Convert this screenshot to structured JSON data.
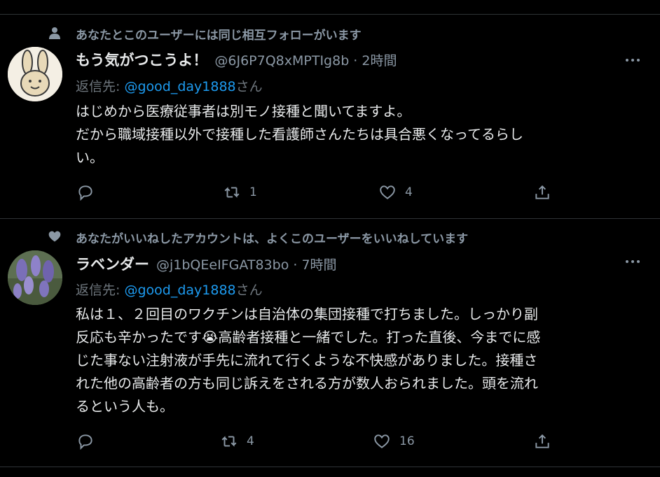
{
  "tweets": [
    {
      "social_context": "あなたとこのユーザーには同じ相互フォローがいます",
      "social_icon": "person-icon",
      "display_name": "もう気がつこうよ！",
      "handle_time": "@6J6P7Q8xMPTIg8b · 2時間",
      "reply_prefix": "返信先: ",
      "reply_mention": "@good_day1888",
      "reply_suffix": "さん",
      "body_lines": [
        "はじめから医療従事者は別モノ接種と聞いてますよ。",
        "だから職域接種以外で接種した看護師さんたちは具合悪くなってるらし",
        "い。"
      ],
      "retweets": "1",
      "likes": "4"
    },
    {
      "social_context": "あなたがいいねしたアカウントは、よくこのユーザーをいいねしています",
      "social_icon": "heart-icon",
      "display_name": "ラベンダー",
      "handle_time": "@j1bQEeIFGAT83bo · 7時間",
      "reply_prefix": "返信先: ",
      "reply_mention": "@good_day1888",
      "reply_suffix": "さん",
      "body_lines": [
        "私は１、２回目のワクチンは自治体の集団接種で打ちました。しっかり副",
        "反応も辛かったです😭高齢者接種と一緒でした。打った直後、今までに感",
        "じた事ない注射液が手先に流れて行くような不快感がありました。接種さ",
        "れた他の高齢者の方も同じ訴えをされる方が数人おられました。頭を流れ",
        "るという人も。"
      ],
      "retweets": "4",
      "likes": "16"
    }
  ],
  "colors": {
    "background": "#000000",
    "text": "#e7e9ea",
    "muted": "#8b98a5",
    "link": "#1d9bf0",
    "divider": "#2f3336"
  }
}
